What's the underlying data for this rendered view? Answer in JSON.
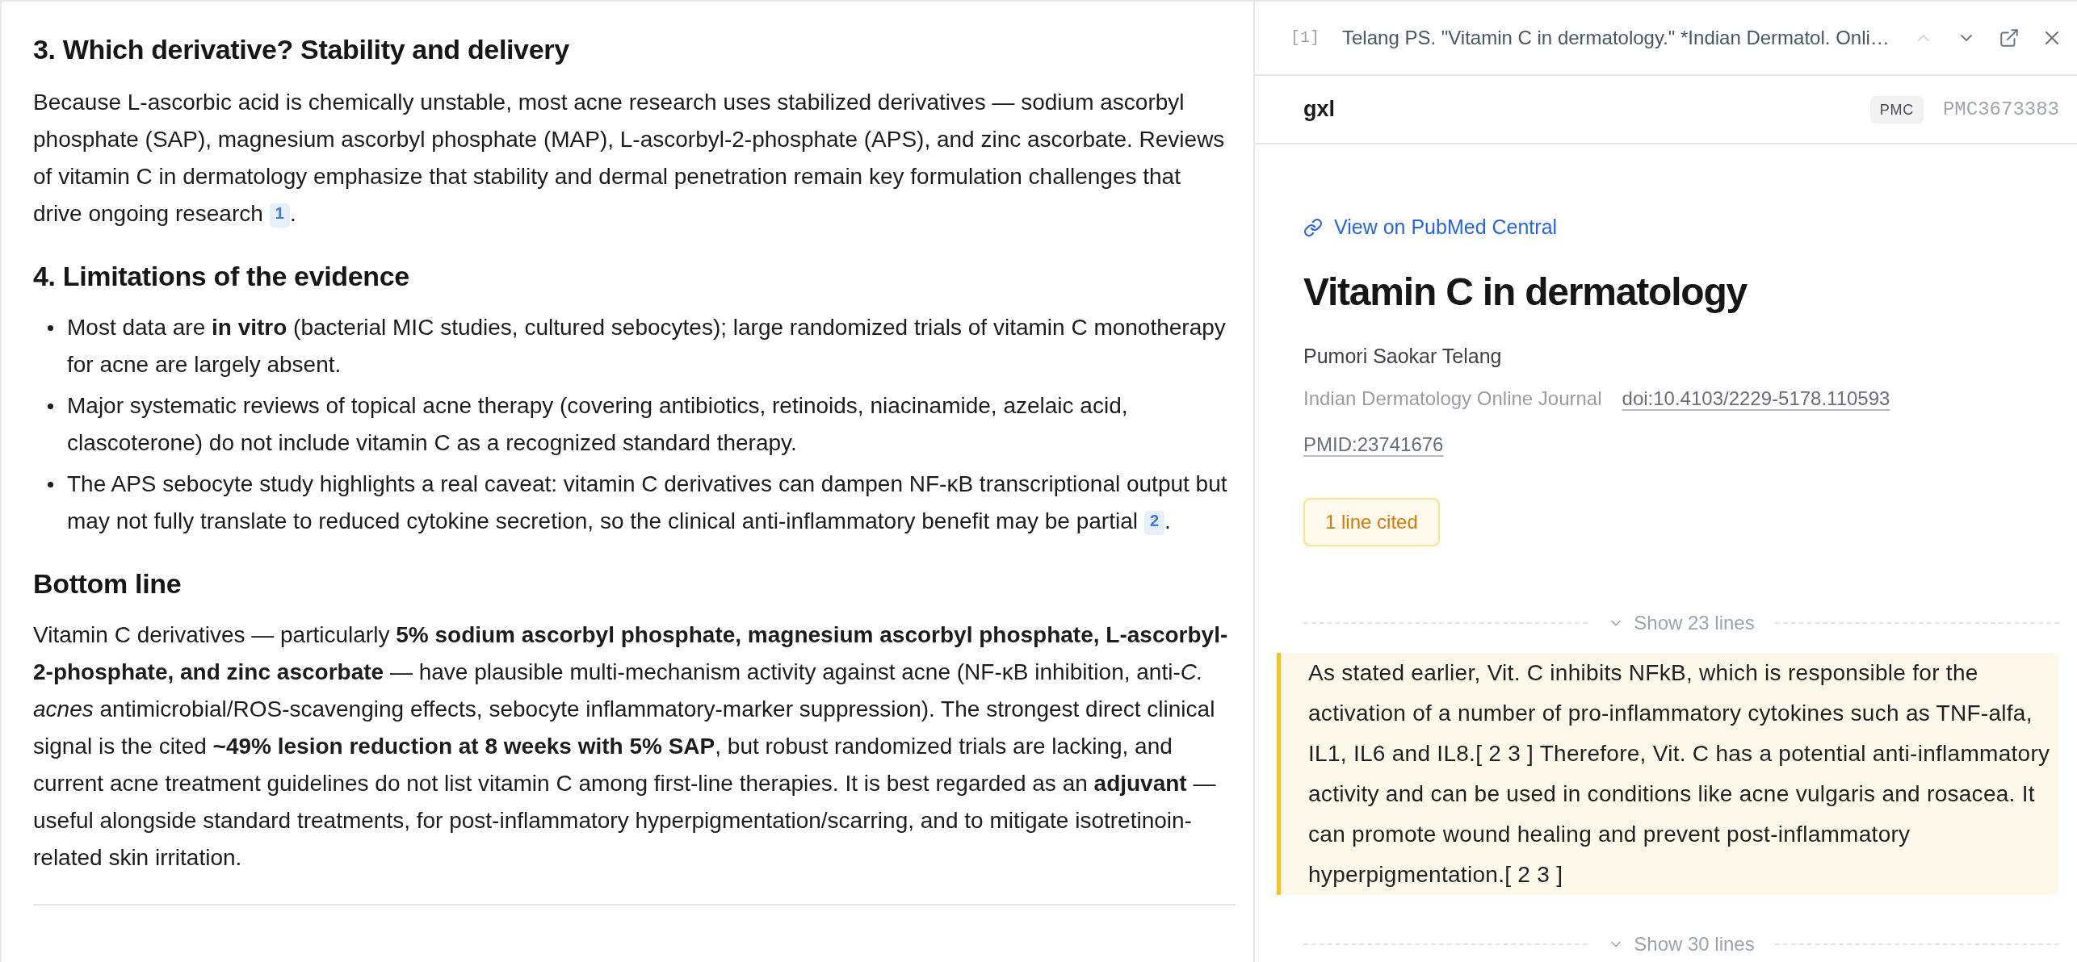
{
  "article": {
    "sections": [
      {
        "heading": "3. Which derivative? Stability and delivery",
        "blocks": [
          {
            "kind": "paragraph",
            "text": "Because L-ascorbic acid is chemically unstable, most acne research uses stabilized derivatives — sodium ascorbyl phosphate (SAP), magnesium ascorbyl phosphate (MAP), L-ascorbyl-2-phosphate (APS), and zinc ascorbate. Reviews of vitamin C in dermatology emphasize that stability and dermal penetration remain key formulation challenges that drive ongoing research",
            "citation": "1",
            "after": "."
          }
        ]
      },
      {
        "heading": "4. Limitations of the evidence",
        "blocks": [
          {
            "kind": "bullets",
            "items": [
              {
                "text": "Most data are **in vitro** (bacterial MIC studies, cultured sebocytes); large randomized trials of vitamin C monotherapy for acne are largely absent."
              },
              {
                "text": "Major systematic reviews of topical acne therapy (covering antibiotics, retinoids, niacinamide, azelaic acid, clascoterone) do not include vitamin C as a recognized standard therapy."
              },
              {
                "text": "The APS sebocyte study highlights a real caveat: vitamin C derivatives can dampen NF-κB transcriptional output but may not fully translate to reduced cytokine secretion, so the clinical anti-inflammatory benefit may be partial",
                "citation": "2",
                "after": "."
              }
            ]
          }
        ]
      },
      {
        "heading": "Bottom line",
        "blocks": [
          {
            "kind": "paragraph",
            "text": "Vitamin C derivatives — particularly **5% sodium ascorbyl phosphate, magnesium ascorbyl phosphate, L-ascorbyl-2-phosphate, and zinc ascorbate** — have plausible multi-mechanism activity against acne (NF-κB inhibition, anti-*C. acnes* antimicrobial/ROS-scavenging effects, sebocyte inflammatory-marker suppression). The strongest direct clinical signal is the cited **~49% lesion reduction at 8 weeks with 5% SAP**, but robust randomized trials are lacking, and current acne treatment guidelines do not list vitamin C among first-line therapies. It is best regarded as an **adjuvant** — useful alongside standard treatments, for post-inflammatory hyperpigmentation/scarring, and to mitigate isotretinoin-related skin irritation."
          }
        ]
      }
    ]
  },
  "reference_panel": {
    "header": {
      "index": "[1]",
      "title": "Telang PS. \"Vitamin C in dermatology.\" *Indian Dermatol. Onli…",
      "buttons": [
        {
          "kind": "previous",
          "disabled": true
        },
        {
          "kind": "next",
          "disabled": false
        },
        {
          "kind": "open_external",
          "disabled": false
        },
        {
          "kind": "close",
          "disabled": false
        }
      ]
    },
    "source": {
      "name": "gxl",
      "tag": "PMC",
      "id": "PMC3673383"
    },
    "link": "View on PubMed Central",
    "title": "Vitamin C in dermatology",
    "authors": "Pumori Saokar Telang",
    "journal": "Indian Dermatology Online Journal",
    "doi": "doi:10.4103/2229-5178.110593",
    "pmid": "PMID:23741676",
    "cited_tag": "1 line cited",
    "excerpt": [
      {
        "kind": "collapsed",
        "label": "Show 23 lines"
      },
      {
        "kind": "cited",
        "text": "As stated earlier, Vit. C inhibits NFkB, which is responsible for the activation of a number of pro-inflammatory cytokines such as TNF-alfa, IL1, IL6 and IL8.[ 2 3 ] Therefore, Vit. C has a potential anti-inflammatory activity and can be used in conditions like acne vulgaris and rosacea. It can promote wound healing and prevent post-inflammatory hyperpigmentation.[ 2 3 ]"
      },
      {
        "kind": "collapsed",
        "label": "Show 30 lines"
      }
    ]
  }
}
